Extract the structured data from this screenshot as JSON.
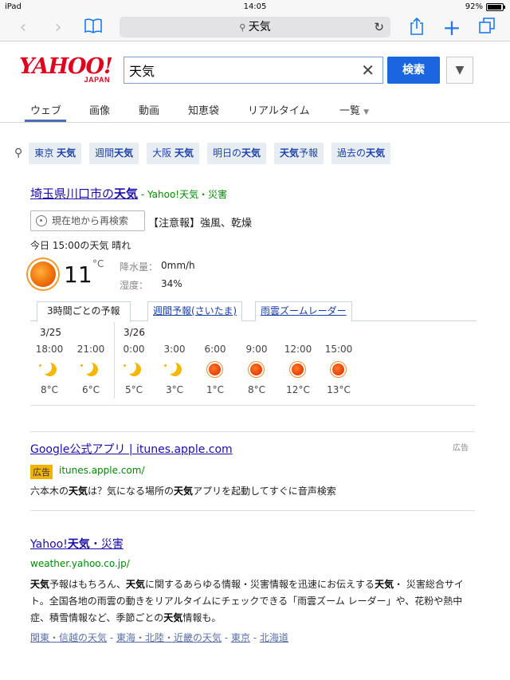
{
  "statusbar": {
    "device": "iPad",
    "time": "14:05",
    "battery": "92%",
    "battery_level": 0.92
  },
  "browser": {
    "url_text": "天気"
  },
  "header": {
    "logo_main": "YAHOO!",
    "logo_sub": "JAPAN",
    "search_value": "天気",
    "search_button": "検索",
    "menu_glyph": "▼"
  },
  "tabs": [
    {
      "label": "ウェブ"
    },
    {
      "label": "画像"
    },
    {
      "label": "動画"
    },
    {
      "label": "知恵袋"
    },
    {
      "label": "リアルタイム"
    },
    {
      "label": "一覧"
    }
  ],
  "related": [
    {
      "pre": "東京 ",
      "bold": "天気",
      "post": ""
    },
    {
      "pre": "週間",
      "bold": "天気",
      "post": ""
    },
    {
      "pre": "大阪 ",
      "bold": "天気",
      "post": ""
    },
    {
      "pre": "明日の",
      "bold": "天気",
      "post": ""
    },
    {
      "pre": "",
      "bold": "天気",
      "post": "予報"
    },
    {
      "pre": "過去の",
      "bold": "天気",
      "post": ""
    }
  ],
  "weather": {
    "title_pre": "埼玉県川口市の",
    "title_bold": "天気",
    "source": " - Yahoo!天気・災害",
    "relocate_label": "現在地から再検索",
    "warning": "【注意報】強風、乾燥",
    "today": "今日 15:00の天気 晴れ",
    "temp": "11",
    "temp_unit": "°C",
    "precip_label": "降水量：",
    "precip_value": "0mm/h",
    "humidity_label": "湿度：",
    "humidity_value": "34%",
    "forecast_tabs": [
      "3時間ごとの予報",
      "週間予報(さいたま)",
      "雨雲ズームレーダー"
    ],
    "dates": [
      "3/25",
      "3/26"
    ],
    "forecast": [
      {
        "time": "18:00",
        "icon": "moon-icon",
        "temp": "8°C"
      },
      {
        "time": "21:00",
        "icon": "moon-icon",
        "temp": "6°C"
      },
      {
        "time": "0:00",
        "icon": "moon-icon",
        "temp": "5°C"
      },
      {
        "time": "3:00",
        "icon": "moon-icon",
        "temp": "3°C"
      },
      {
        "time": "6:00",
        "icon": "sun-icon",
        "temp": "1°C"
      },
      {
        "time": "9:00",
        "icon": "sun-icon",
        "temp": "8°C"
      },
      {
        "time": "12:00",
        "icon": "sun-icon",
        "temp": "12°C"
      },
      {
        "time": "15:00",
        "icon": "sun-icon",
        "temp": "13°C"
      }
    ]
  },
  "results": [
    {
      "title": "Google公式アプリ | itunes.apple.com",
      "ad_label": "広告",
      "ad_badge": "広告",
      "url": "itunes.apple.com/",
      "desc_html_parts": [
        "六本木の",
        "天気",
        "は？気になる場所の",
        "天気",
        "アプリを起動してすぐに音声検索"
      ]
    },
    {
      "title_pre": "Yahoo!",
      "title_bold": "天気",
      "title_post": "・災害",
      "url": "weather.yahoo.co.jp/",
      "desc_parts": [
        [
          "天気",
          true
        ],
        [
          "予報はもちろん、",
          false
        ],
        [
          "天気",
          true
        ],
        [
          "に関するあらゆる情報・災害情報を迅速にお伝えする",
          false
        ],
        [
          "天気",
          true
        ],
        [
          "・ 災害総合サイト。全国各地の雨雲の動きをリアルタイムにチェックできる「雨雲ズーム レーダー」や、花粉や熱中症、積雪情報など、季節ごとの",
          false
        ],
        [
          "天気",
          true
        ],
        [
          "情報も。",
          false
        ]
      ],
      "links": [
        "関東・信越の天気",
        "東海・北陸・近畿の天気",
        "東京",
        "北海道"
      ]
    }
  ]
}
